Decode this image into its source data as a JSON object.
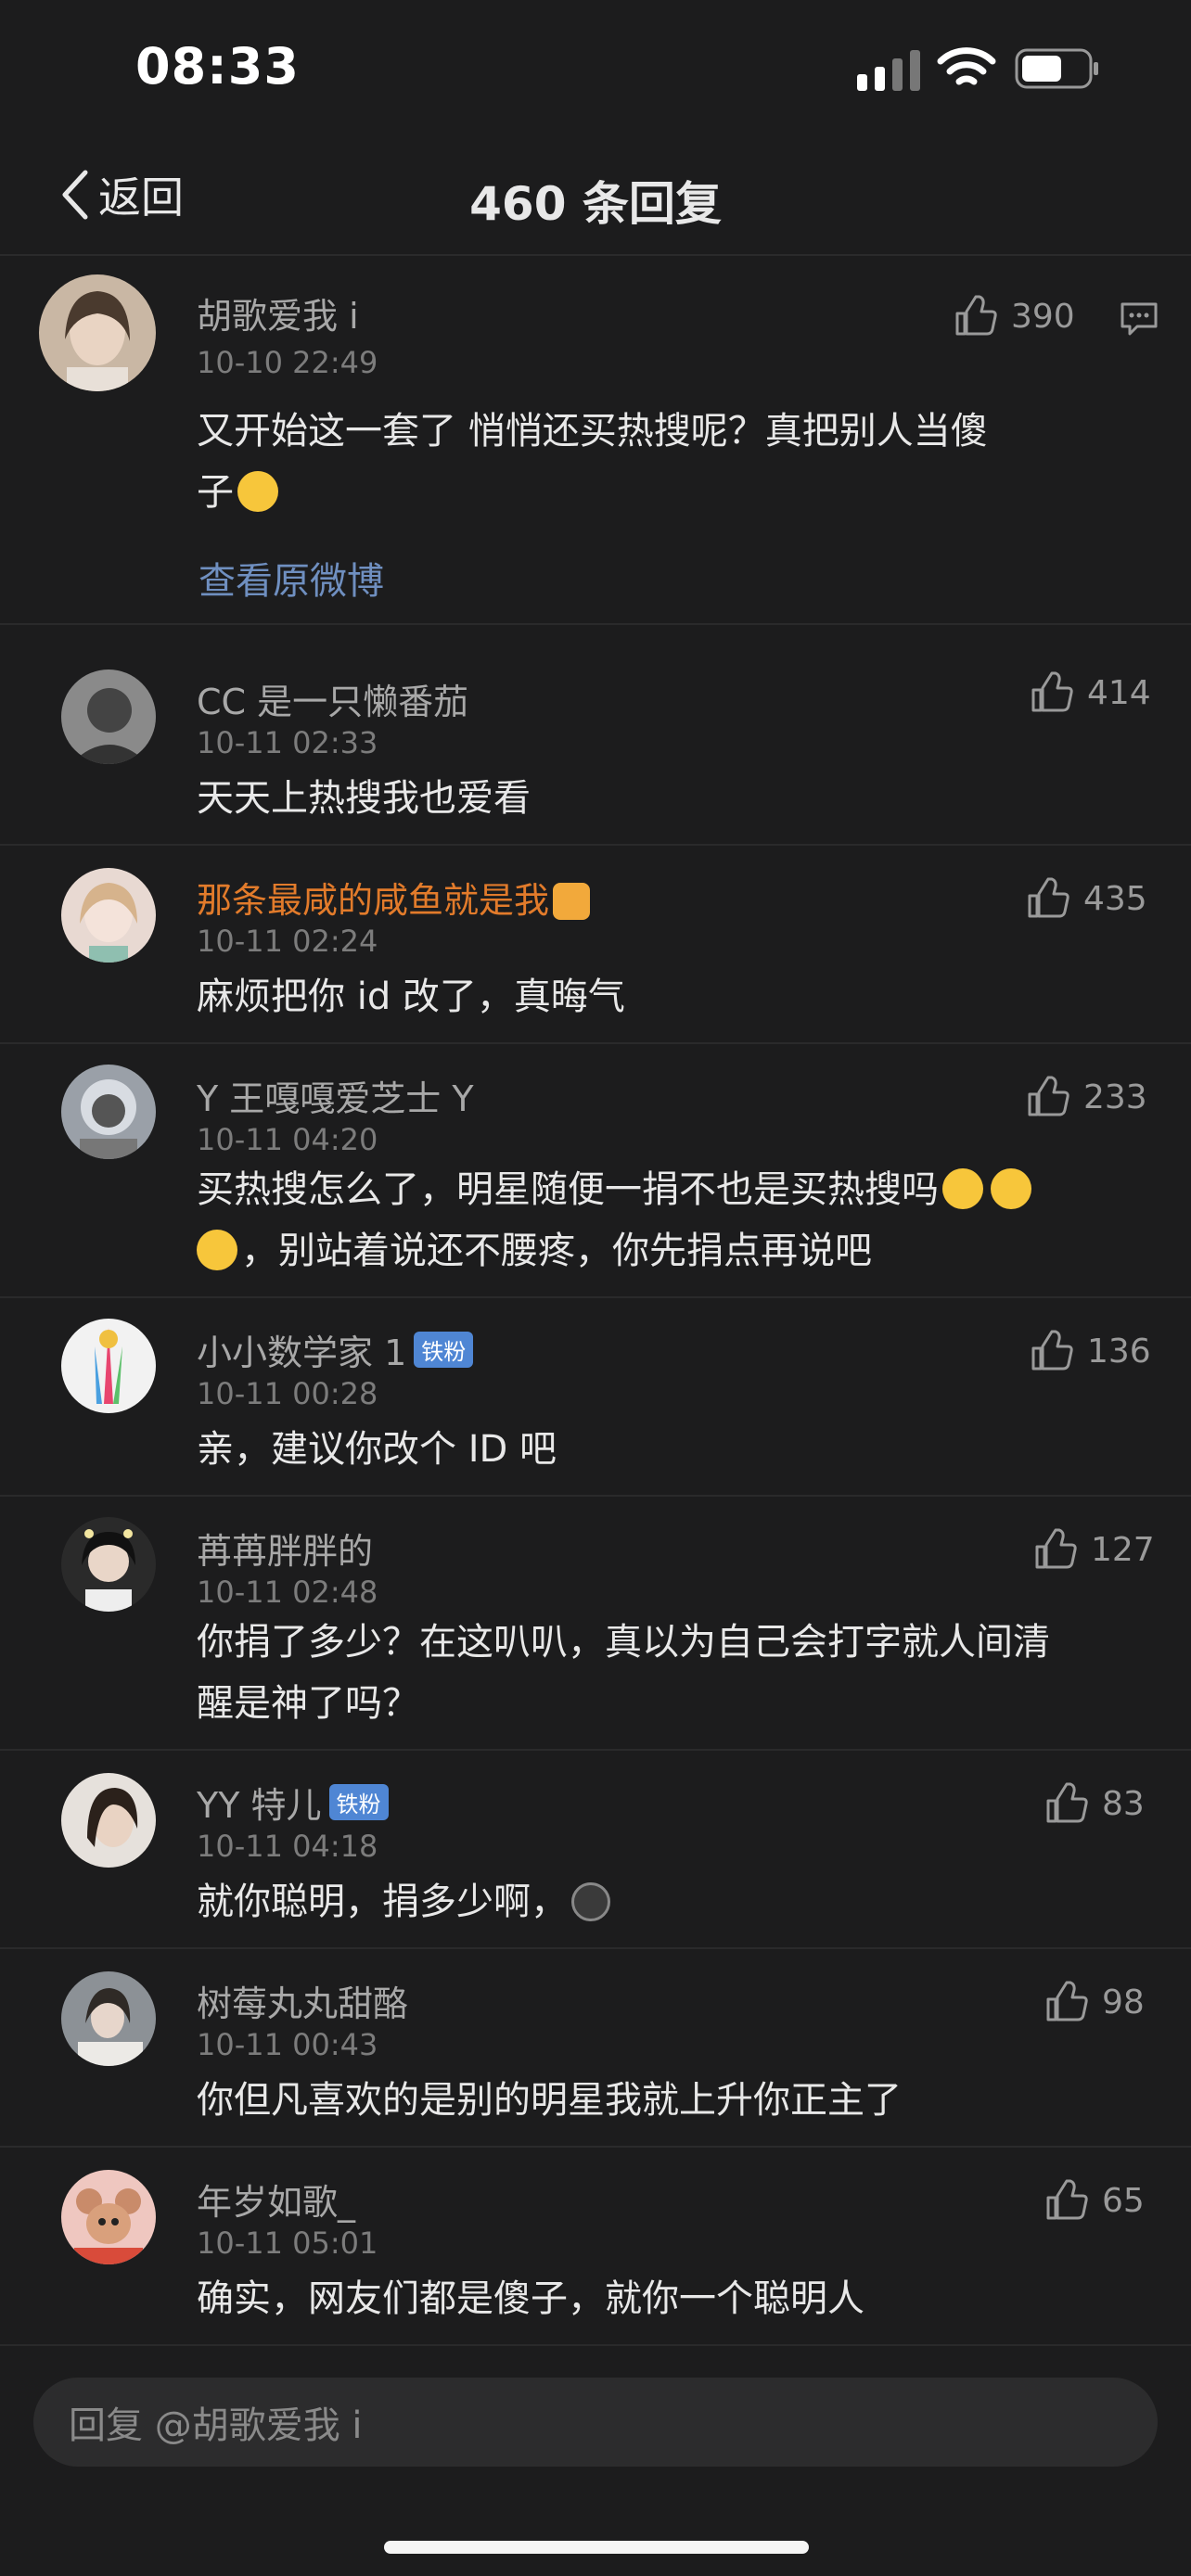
{
  "status": {
    "time": "08:33"
  },
  "nav": {
    "back_label": "返回",
    "title": "460 条回复"
  },
  "main_comment": {
    "username": "胡歌爱我 i",
    "date": "10-10 22:49",
    "likes": "390",
    "text_line1": "又开始这一套了  悄悄还买热搜呢？真把别人当傻",
    "text_line2": "子",
    "link": "查看原微博"
  },
  "replies": [
    {
      "username": "CC 是一只懒番茄",
      "date": "10-11 02:33",
      "likes": "414",
      "text": "天天上热搜我也爱看"
    },
    {
      "username": "那条最咸的咸鱼就是我",
      "date": "10-11 02:24",
      "likes": "435",
      "text": "麻烦把你 id 改了，真晦气",
      "name_color": "#e27b2b"
    },
    {
      "username": "Y 王嘎嘎爱芝士 Y",
      "date": "10-11 04:20",
      "likes": "233",
      "text_line1": "买热搜怎么了，明星随便一捐不也是买热搜吗",
      "text_line2": "，别站着说还不腰疼，你先捐点再说吧"
    },
    {
      "username": "小小数学家 1",
      "badge": "铁粉",
      "date": "10-11 00:28",
      "likes": "136",
      "text": "亲，建议你改个 ID 吧"
    },
    {
      "username": "苒苒胖胖的",
      "date": "10-11 02:48",
      "likes": "127",
      "text_line1": "你捐了多少？在这叭叭，真以为自己会打字就人间清",
      "text_line2": "醒是神了吗？"
    },
    {
      "username": "YY 特儿",
      "badge": "铁粉",
      "date": "10-11 04:18",
      "likes": "83",
      "text": "就你聪明，捐多少啊，"
    },
    {
      "username": "树莓丸丸甜酪",
      "date": "10-11 00:43",
      "likes": "98",
      "text": "你但凡喜欢的是别的明星我就上升你正主了"
    },
    {
      "username": "年岁如歌_",
      "date": "10-11 05:01",
      "likes": "65",
      "text": "确实，网友们都是傻子，就你一个聪明人"
    }
  ],
  "input": {
    "placeholder": "回复 @胡歌爱我 i"
  },
  "colors": {
    "background": "#1c1c1d",
    "link": "#6f8fc0",
    "orange_name": "#e27b2b",
    "badge": "#4f86d4"
  }
}
